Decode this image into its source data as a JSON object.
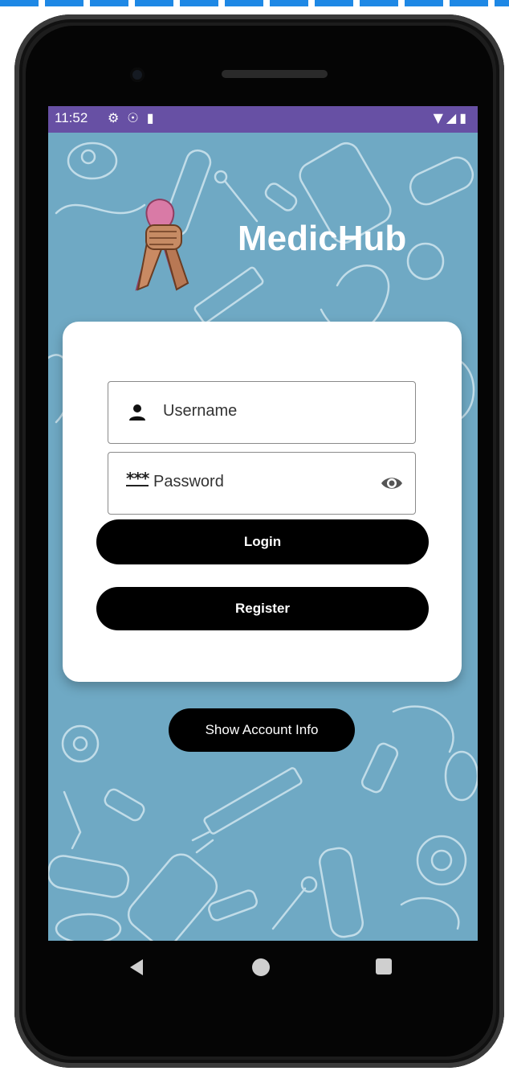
{
  "status_bar": {
    "time": "11:52",
    "left_icons": [
      "gear-icon",
      "usb-icon",
      "sd-card-icon"
    ],
    "right_icons": [
      "wifi-icon",
      "signal-icon",
      "battery-icon"
    ],
    "color": "#6750a4"
  },
  "app": {
    "title": "MedicHub",
    "logo_icon": "awareness-ribbon-fist-icon"
  },
  "login_form": {
    "username_placeholder": "Username",
    "password_placeholder": "Password",
    "password_mask_glyph": "***",
    "login_label": "Login",
    "register_label": "Register"
  },
  "account_button_label": "Show Account Info",
  "nav_bar": {
    "icons": [
      "back-icon",
      "home-icon",
      "recents-icon"
    ]
  },
  "colors": {
    "background": "#6fa9c4",
    "button": "#000000",
    "card": "#ffffff"
  }
}
